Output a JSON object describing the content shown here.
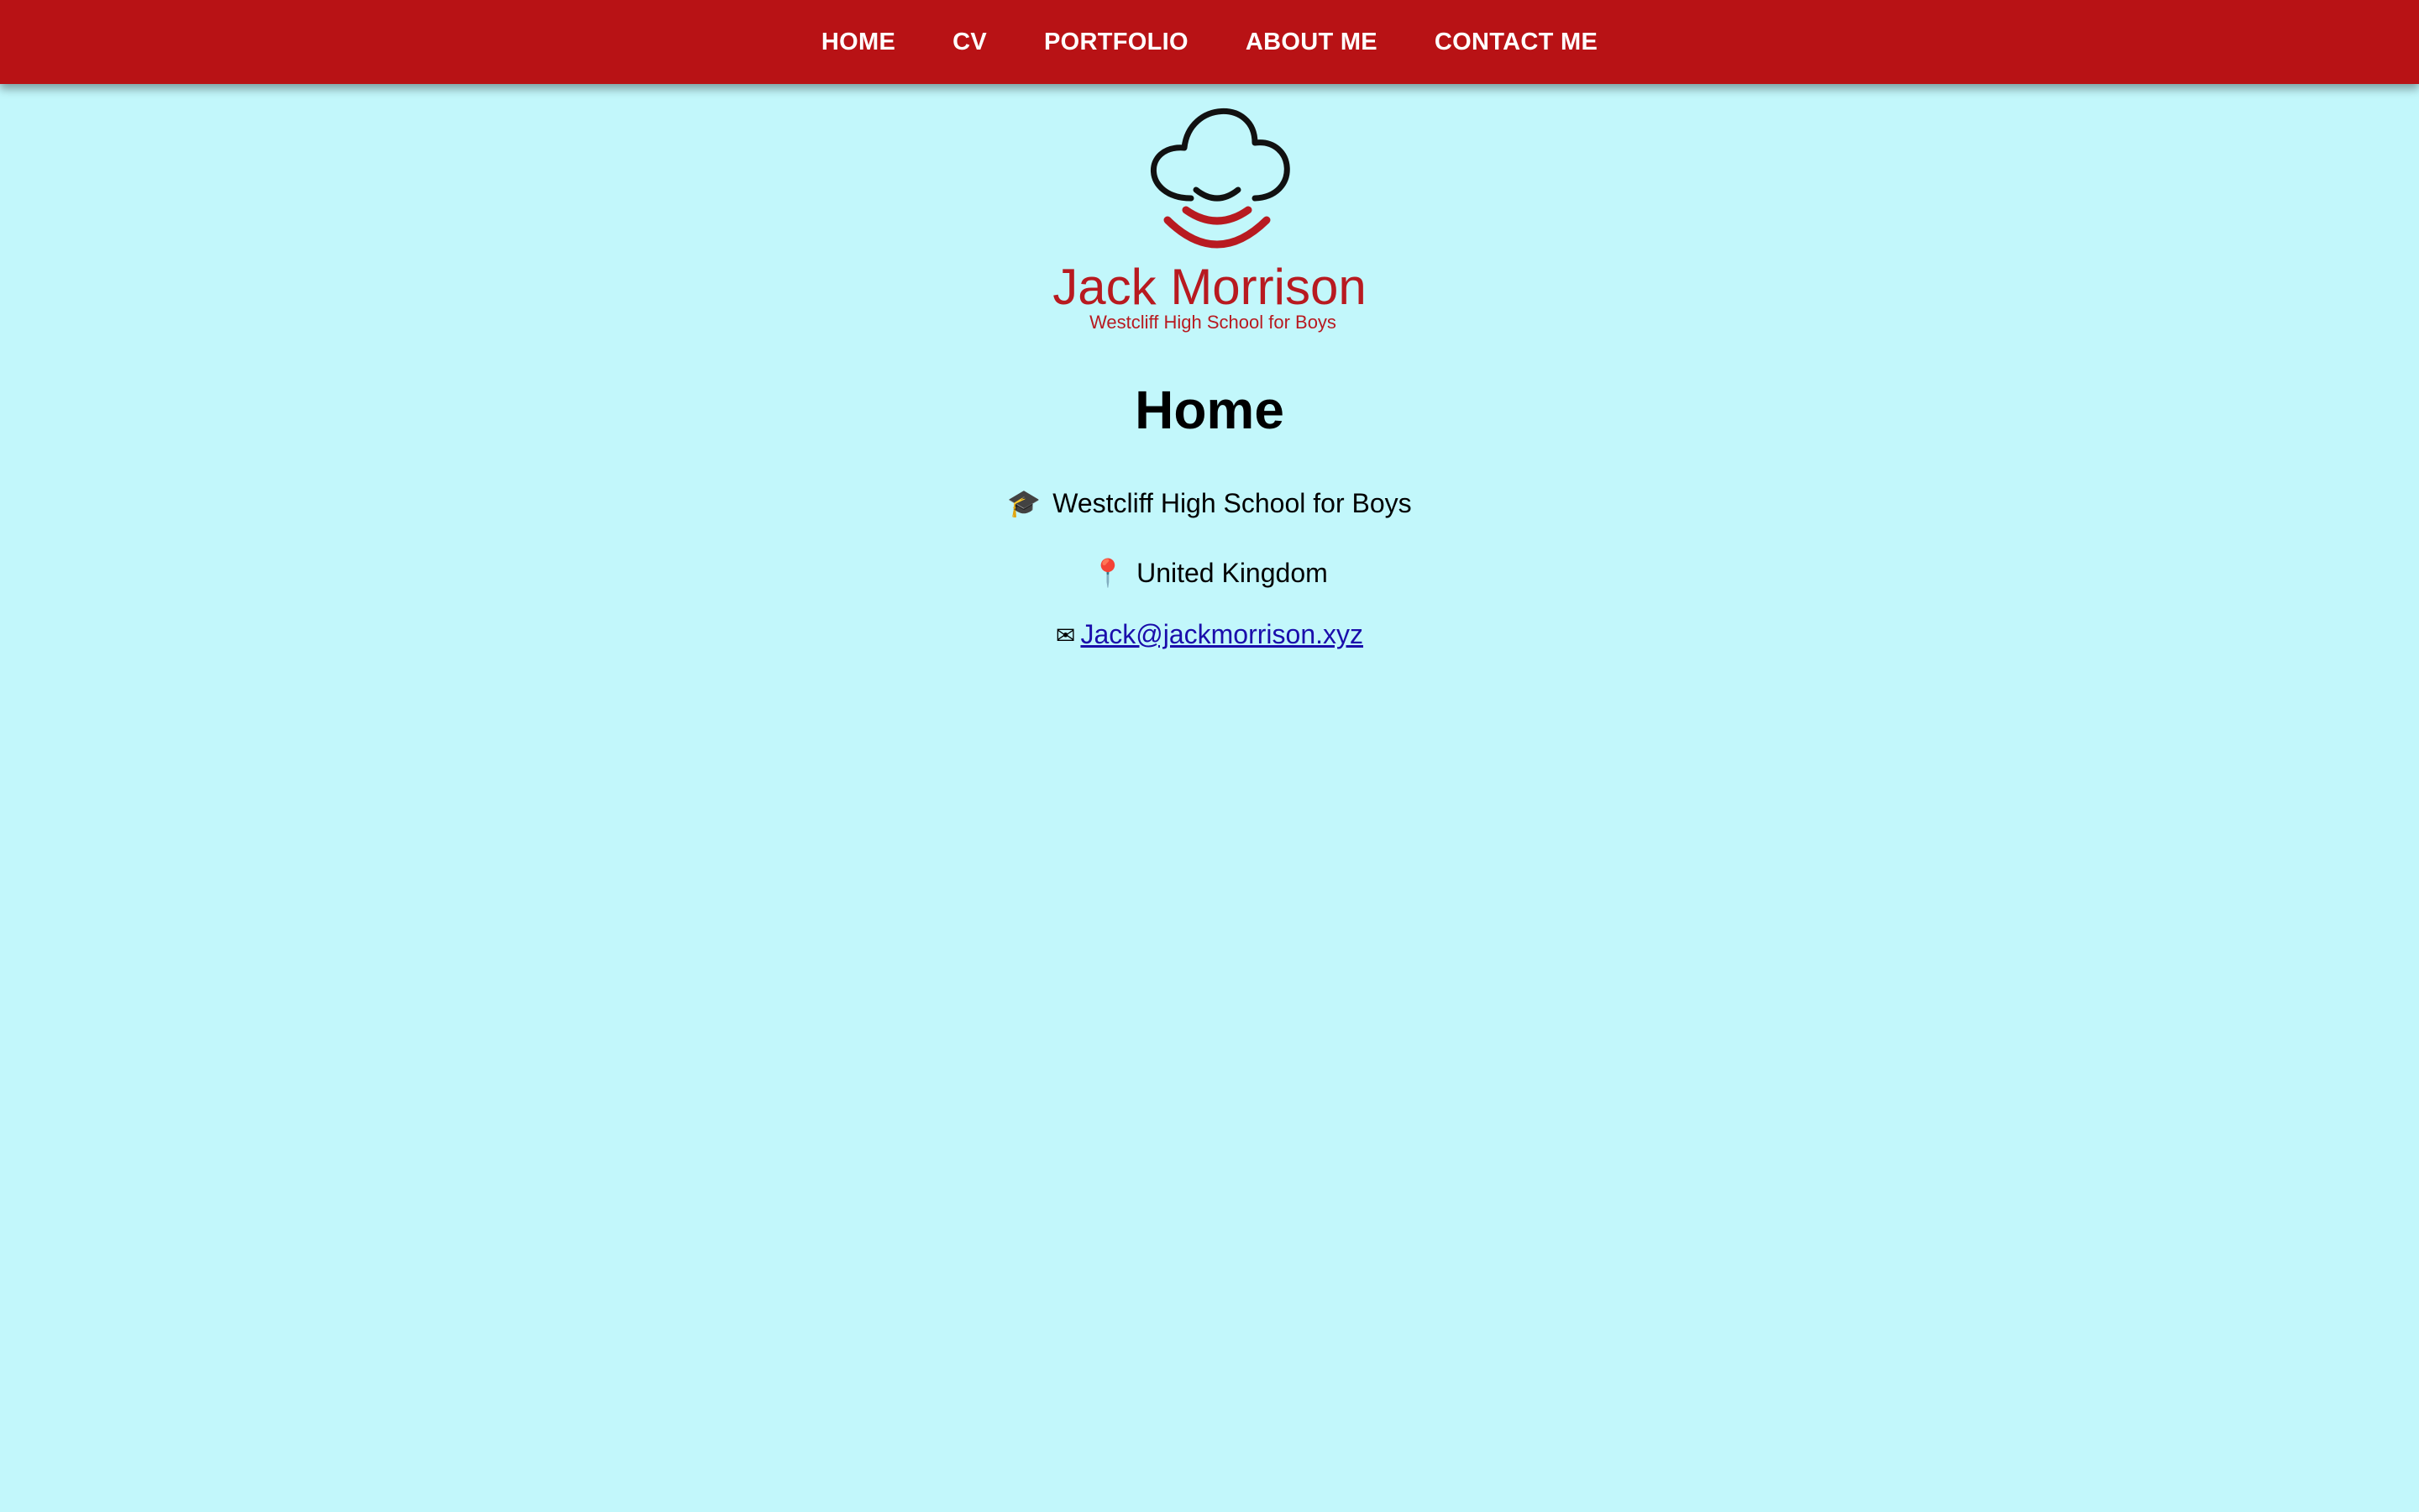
{
  "nav": {
    "items": [
      {
        "label": "HOME"
      },
      {
        "label": "CV"
      },
      {
        "label": "PORTFOLIO"
      },
      {
        "label": "ABOUT ME"
      },
      {
        "label": "CONTACT ME"
      }
    ]
  },
  "logo": {
    "name": "Jack Morrison",
    "subtitle": "Westcliff High School for Boys",
    "icon": "cloud-signal-icon"
  },
  "main": {
    "title": "Home",
    "school": {
      "icon": "graduation-cap-icon",
      "glyph": "🎓",
      "text": "Westcliff High School for Boys"
    },
    "location": {
      "icon": "pin-icon",
      "glyph": "📍",
      "text": "United Kingdom"
    },
    "email": {
      "icon": "envelope-icon",
      "glyph": "✉",
      "text": "Jack@jackmorrison.xyz"
    }
  },
  "colors": {
    "nav_bg": "#b81215",
    "page_bg": "#c2f7fb",
    "brand_red": "#b81a20",
    "link": "#1a0dab"
  }
}
